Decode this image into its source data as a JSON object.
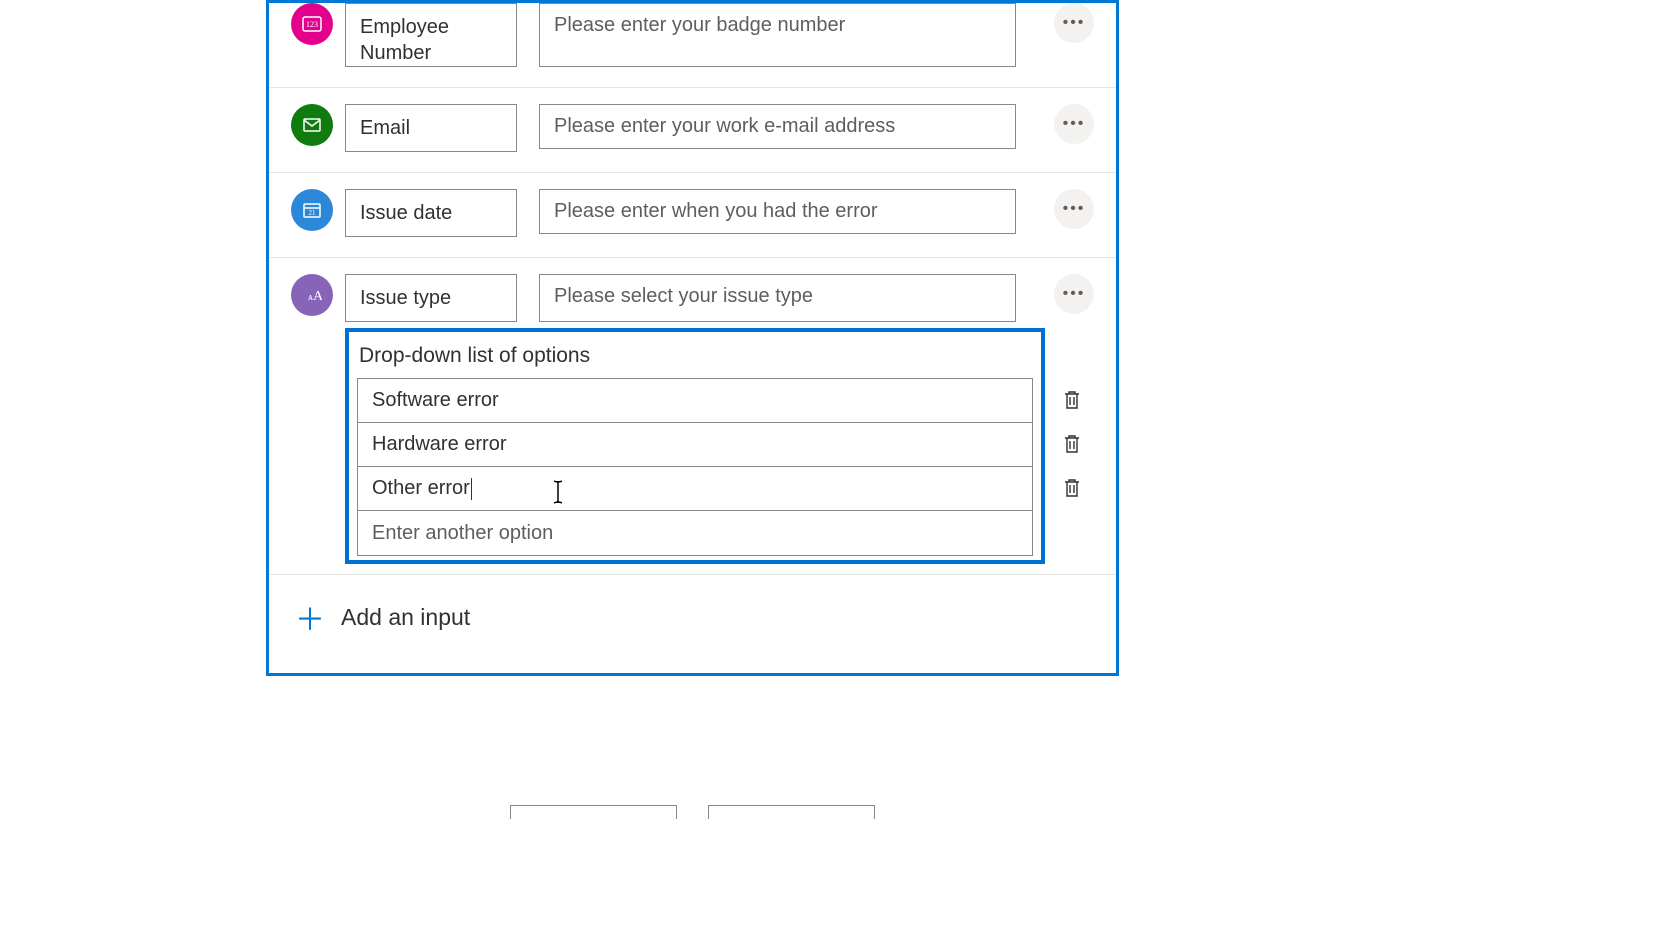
{
  "fields": [
    {
      "name": "Employee Number",
      "desc": "Please enter your badge number",
      "icon": "number",
      "color": "pink"
    },
    {
      "name": "Email",
      "desc": "Please enter your work e-mail address",
      "icon": "mail",
      "color": "green"
    },
    {
      "name": "Issue date",
      "desc": "Please enter when you had the error",
      "icon": "calendar",
      "color": "blue"
    },
    {
      "name": "Issue type",
      "desc": "Please select your issue type",
      "icon": "text",
      "color": "purple"
    }
  ],
  "dropdown": {
    "title": "Drop-down list of options",
    "options": [
      "Software error",
      "Hardware error",
      "Other error"
    ],
    "new_option_placeholder": "Enter another option"
  },
  "add_input_label": "Add an input"
}
